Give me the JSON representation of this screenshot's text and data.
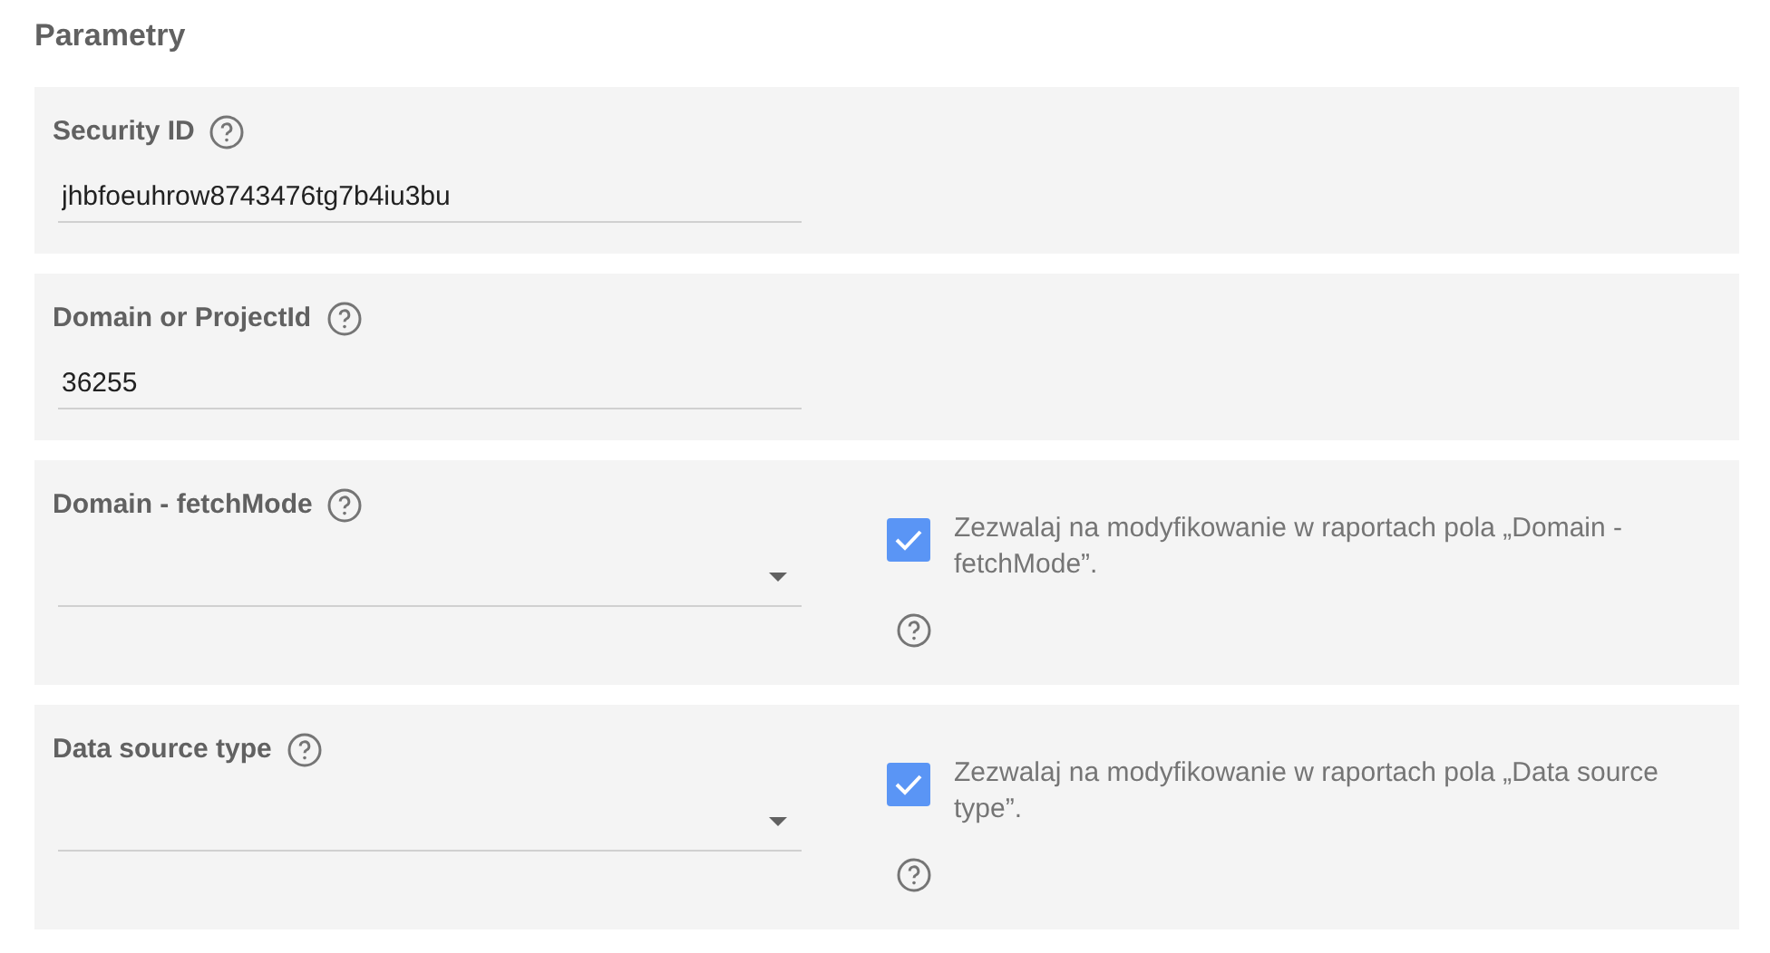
{
  "title": "Parametry",
  "params": [
    {
      "kind": "text",
      "label": "Security ID",
      "value": "jhbfoeuhrow8743476tg7b4iu3bu"
    },
    {
      "kind": "text",
      "label": "Domain or ProjectId",
      "value": "36255"
    },
    {
      "kind": "select",
      "label": "Domain - fetchMode",
      "allow_edit": {
        "checked": true,
        "text": "Zezwalaj na modyfikowanie w raportach pola „Domain - fetchMode”."
      }
    },
    {
      "kind": "select",
      "label": "Data source type",
      "allow_edit": {
        "checked": true,
        "text": "Zezwalaj na modyfikowanie w raportach pola „Data source type”."
      }
    }
  ]
}
